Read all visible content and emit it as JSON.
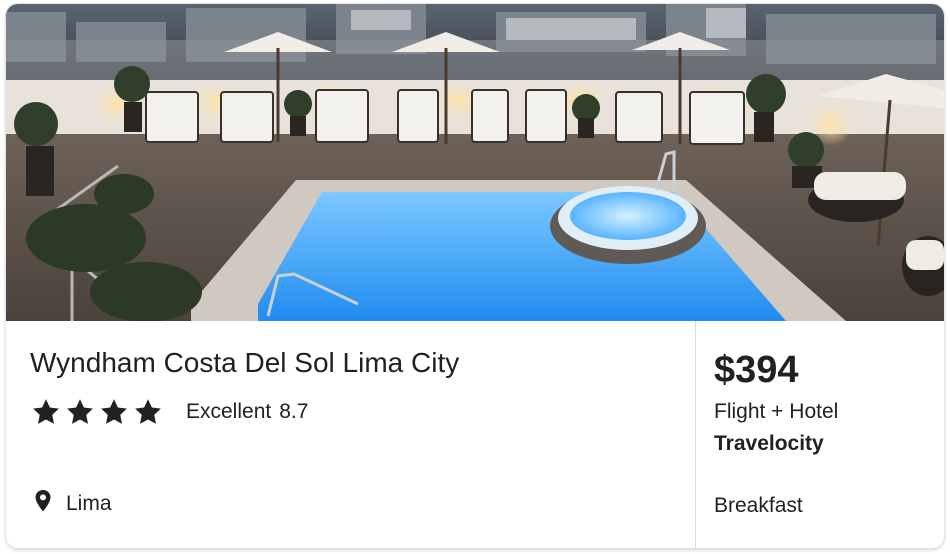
{
  "hotel": {
    "name": "Wyndham Costa Del Sol Lima City",
    "star_count": 4,
    "rating_label": "Excellent",
    "rating_score": "8.7",
    "location": "Lima"
  },
  "deal": {
    "price": "$394",
    "package": "Flight + Hotel",
    "provider": "Travelocity",
    "amenity": "Breakfast"
  },
  "icons": {
    "star": "star-icon",
    "location": "map-pin-icon"
  },
  "colors": {
    "text": "#202124",
    "divider": "#dadada",
    "pool": "#3aa6ff"
  }
}
